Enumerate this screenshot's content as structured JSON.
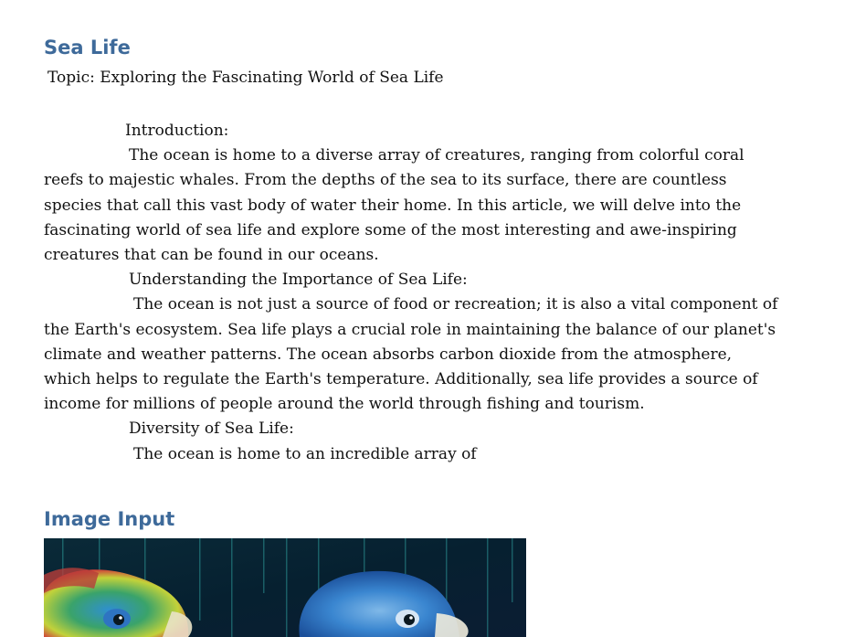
{
  "document": {
    "title": "Sea Life",
    "topic": "Topic: Exploring the Fascinating World of Sea Life",
    "intro_heading": "Introduction:",
    "intro_lines": [
      "The ocean is home to a diverse array of creatures, ranging from colorful coral",
      "reefs to majestic whales. From the depths of the sea to its surface, there are countless",
      "species that call this vast body of water their home. In this article, we will delve into the",
      "fascinating world of sea life and explore some of the most interesting and awe-inspiring",
      "creatures that can be found in our oceans."
    ],
    "importance_heading": "Understanding the Importance of Sea Life:",
    "importance_lines": [
      "The ocean is not just a source of food or recreation; it is also a vital component of",
      "the Earth's ecosystem. Sea life plays a crucial role in maintaining the balance of our planet's",
      "climate and weather patterns. The ocean absorbs carbon dioxide from the atmosphere,",
      "which helps to regulate the Earth's temperature. Additionally, sea life provides a source of",
      "income for millions of people around the world through fishing and tourism."
    ],
    "diversity_heading": "Diversity of Sea Life:",
    "diversity_lines": [
      "The ocean is home to an incredible array of"
    ]
  },
  "image_section": {
    "title": "Image Input",
    "image_subject": "two-parrots-digital-rain"
  },
  "colors": {
    "heading": "#3e6a9a",
    "text": "#111111",
    "background": "#ffffff"
  }
}
